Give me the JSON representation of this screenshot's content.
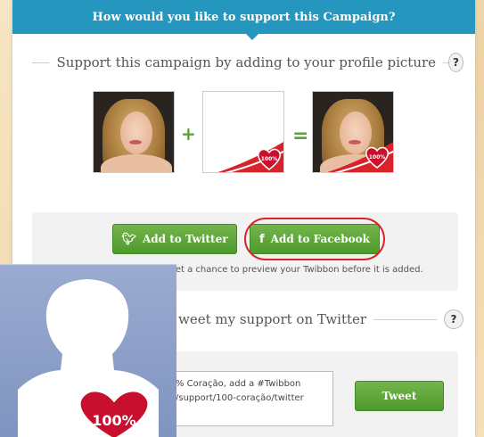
{
  "header": {
    "title": "How would you like to support this Campaign?"
  },
  "profile_section": {
    "title": "Support this campaign by adding to your profile picture",
    "help": "?",
    "plus": "+",
    "equals": "=",
    "badge_text": "100%"
  },
  "actions": {
    "twitter_label": "Add to Twitter",
    "twitter_icon": "twitter-bird-icon",
    "facebook_label": "Add to Facebook",
    "facebook_icon": "facebook-f-icon",
    "note": "Don't worry, you'll get a chance to preview your Twibbon before it is added."
  },
  "tweet_section": {
    "title": "weet my support on Twitter",
    "help": "?",
    "textarea_value": "% Coração, add a #Twibbon\n/support/100-coração/twitter",
    "tweet_button": "Tweet"
  },
  "colors": {
    "header_bg": "#2596be",
    "button_green": "#5aa336",
    "highlight_red": "#d8232a",
    "overlay_blue": "#8a9ec7"
  }
}
